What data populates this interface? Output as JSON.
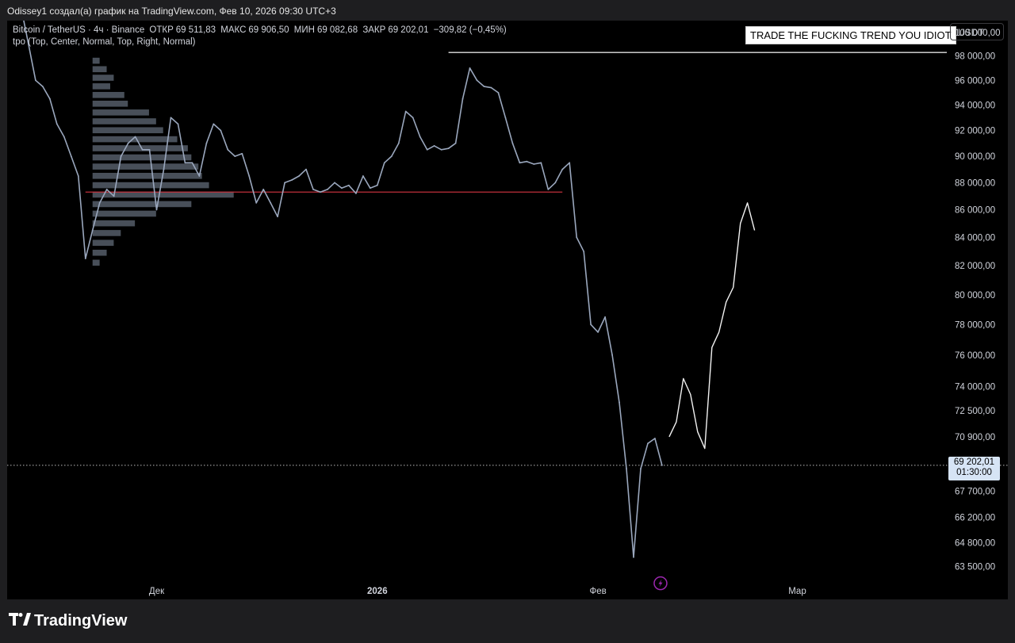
{
  "header": {
    "caption": "Odissey1 создал(а) график на TradingView.com, Фев 10, 2026 09:30 UTC+3"
  },
  "legend": {
    "symbol": "Bitcoin / TetherUS · 4ч · Binance",
    "open_label": "ОТКР",
    "open_value": "69 511,83",
    "high_label": "МАКС",
    "high_value": "69 906,50",
    "low_label": "МИН",
    "low_value": "69 082,68",
    "close_label": "ЗАКР",
    "close_value": "69 202,01",
    "change": "−309,82 (−0,45%)",
    "indicator": "tpo (Top, Center, Normal, Top, Right, Normal)"
  },
  "banner": {
    "text": "TRADE THE FUCKING TREND YOU IDIOT"
  },
  "currency": {
    "label": "USDT"
  },
  "last_price": {
    "price": "69 202,01",
    "countdown": "01:30:00"
  },
  "footer": {
    "brand": "TradingView"
  },
  "colors": {
    "background": "#000000",
    "candles": "#9aa7bd",
    "poc_line": "#c0303b",
    "volume_profile": "#505863",
    "price_tag": "#d6e4f5",
    "marker": "#9c27b0"
  },
  "icons": {
    "brand_logo": "tradingview-logo",
    "event_marker": "lightning-icon"
  },
  "chart_data": {
    "type": "line",
    "title": "Bitcoin / TetherUS · 4ч · Binance",
    "y_scale": "log",
    "ylim": [
      62500,
      101000
    ],
    "y_ticks": [
      100000,
      98000,
      96000,
      94000,
      92000,
      90000,
      88000,
      86000,
      84000,
      82000,
      80000,
      78000,
      76000,
      74000,
      72500,
      70900,
      67700,
      66200,
      64800,
      63500
    ],
    "y_tick_labels": [
      "100 000,00",
      "98 000,00",
      "96 000,00",
      "94 000,00",
      "92 000,00",
      "90 000,00",
      "88 000,00",
      "86 000,00",
      "84 000,00",
      "82 000,00",
      "80 000,00",
      "78 000,00",
      "76 000,00",
      "74 000,00",
      "72 500,00",
      "70 900,00",
      "67 700,00",
      "66 200,00",
      "64 800,00",
      "63 500,00"
    ],
    "x_tick_labels": [
      {
        "label": "Дек",
        "date": "2025-12-01"
      },
      {
        "label": "2026",
        "date": "2026-01-01",
        "bold": true
      },
      {
        "label": "Фев",
        "date": "2026-02-01"
      },
      {
        "label": "Мар",
        "date": "2026-03-01"
      }
    ],
    "xlim": [
      "2025-11-10",
      "2026-03-22"
    ],
    "series": [
      {
        "type": "line",
        "points": [
          [
            "2025-11-11",
            105000
          ],
          [
            "2025-11-12",
            102000
          ],
          [
            "2025-11-13",
            99000
          ],
          [
            "2025-11-14",
            96000
          ],
          [
            "2025-11-15",
            95500
          ],
          [
            "2025-11-16",
            94500
          ],
          [
            "2025-11-17",
            92500
          ],
          [
            "2025-11-18",
            91500
          ],
          [
            "2025-11-19",
            90000
          ],
          [
            "2025-11-20",
            88500
          ],
          [
            "2025-11-21",
            82500
          ],
          [
            "2025-11-22",
            84500
          ],
          [
            "2025-11-23",
            86500
          ],
          [
            "2025-11-24",
            87500
          ],
          [
            "2025-11-25",
            87000
          ],
          [
            "2025-11-26",
            90000
          ],
          [
            "2025-11-27",
            91000
          ],
          [
            "2025-11-28",
            91500
          ],
          [
            "2025-11-29",
            90500
          ],
          [
            "2025-11-30",
            90500
          ],
          [
            "2025-12-01",
            86000
          ],
          [
            "2025-12-02",
            89000
          ],
          [
            "2025-12-03",
            93000
          ],
          [
            "2025-12-04",
            92500
          ],
          [
            "2025-12-05",
            89500
          ],
          [
            "2025-12-06",
            89500
          ],
          [
            "2025-12-07",
            88500
          ],
          [
            "2025-12-08",
            91000
          ],
          [
            "2025-12-09",
            92500
          ],
          [
            "2025-12-10",
            92000
          ],
          [
            "2025-12-11",
            90500
          ],
          [
            "2025-12-12",
            90000
          ],
          [
            "2025-12-13",
            90200
          ],
          [
            "2025-12-14",
            88500
          ],
          [
            "2025-12-15",
            86500
          ],
          [
            "2025-12-16",
            87500
          ],
          [
            "2025-12-17",
            86500
          ],
          [
            "2025-12-18",
            85500
          ],
          [
            "2025-12-19",
            88000
          ],
          [
            "2025-12-20",
            88200
          ],
          [
            "2025-12-21",
            88500
          ],
          [
            "2025-12-22",
            89000
          ],
          [
            "2025-12-23",
            87500
          ],
          [
            "2025-12-24",
            87300
          ],
          [
            "2025-12-25",
            87500
          ],
          [
            "2025-12-26",
            88000
          ],
          [
            "2025-12-27",
            87600
          ],
          [
            "2025-12-28",
            87800
          ],
          [
            "2025-12-29",
            87200
          ],
          [
            "2025-12-30",
            88500
          ],
          [
            "2025-12-31",
            87600
          ],
          [
            "2026-01-01",
            87800
          ],
          [
            "2026-01-02",
            89500
          ],
          [
            "2026-01-03",
            90000
          ],
          [
            "2026-01-04",
            91000
          ],
          [
            "2026-01-05",
            93500
          ],
          [
            "2026-01-06",
            93000
          ],
          [
            "2026-01-07",
            91500
          ],
          [
            "2026-01-08",
            90500
          ],
          [
            "2026-01-09",
            90800
          ],
          [
            "2026-01-10",
            90500
          ],
          [
            "2026-01-11",
            90600
          ],
          [
            "2026-01-12",
            91000
          ],
          [
            "2026-01-13",
            94500
          ],
          [
            "2026-01-14",
            97000
          ],
          [
            "2026-01-15",
            96000
          ],
          [
            "2026-01-16",
            95500
          ],
          [
            "2026-01-17",
            95400
          ],
          [
            "2026-01-18",
            95000
          ],
          [
            "2026-01-19",
            93000
          ],
          [
            "2026-01-20",
            91000
          ],
          [
            "2026-01-21",
            89500
          ],
          [
            "2026-01-22",
            89600
          ],
          [
            "2026-01-23",
            89400
          ],
          [
            "2026-01-24",
            89500
          ],
          [
            "2026-01-25",
            87500
          ],
          [
            "2026-01-26",
            88000
          ],
          [
            "2026-01-27",
            89000
          ],
          [
            "2026-01-28",
            89500
          ],
          [
            "2026-01-29",
            84000
          ],
          [
            "2026-01-30",
            83000
          ],
          [
            "2026-01-31",
            78000
          ],
          [
            "2026-02-01",
            77500
          ],
          [
            "2026-02-02",
            78500
          ],
          [
            "2026-02-03",
            76000
          ],
          [
            "2026-02-04",
            73000
          ],
          [
            "2026-02-05",
            69000
          ],
          [
            "2026-02-06",
            64000
          ],
          [
            "2026-02-07",
            69000
          ],
          [
            "2026-02-08",
            70500
          ],
          [
            "2026-02-09",
            70800
          ],
          [
            "2026-02-10",
            69202
          ]
        ]
      },
      {
        "type": "line",
        "name": "",
        "style": "drawing",
        "points": [
          [
            "2026-02-11",
            70900
          ],
          [
            "2026-02-12",
            71800
          ],
          [
            "2026-02-13",
            74500
          ],
          [
            "2026-02-14",
            73500
          ],
          [
            "2026-02-15",
            71200
          ],
          [
            "2026-02-16",
            70200
          ],
          [
            "2026-02-17",
            76500
          ],
          [
            "2026-02-18",
            77500
          ],
          [
            "2026-02-19",
            79500
          ],
          [
            "2026-02-20",
            80500
          ],
          [
            "2026-02-21",
            85000
          ],
          [
            "2026-02-22",
            86500
          ],
          [
            "2026-02-23",
            84500
          ]
        ]
      }
    ],
    "horizontal_lines": [
      {
        "price": 98300,
        "from": "2026-01-11",
        "color": "#e0e0e0"
      },
      {
        "price": 87300,
        "from": "2025-11-21",
        "to": "2026-01-27",
        "color": "#c0303b"
      },
      {
        "price": 69202.01,
        "color": "#bbbbbb",
        "dotted": true
      }
    ],
    "volume_profile": [
      {
        "price": 97600,
        "volume": 2
      },
      {
        "price": 96900,
        "volume": 4
      },
      {
        "price": 96200,
        "volume": 6
      },
      {
        "price": 95500,
        "volume": 5
      },
      {
        "price": 94800,
        "volume": 9
      },
      {
        "price": 94100,
        "volume": 10
      },
      {
        "price": 93400,
        "volume": 16
      },
      {
        "price": 92700,
        "volume": 18
      },
      {
        "price": 92000,
        "volume": 20
      },
      {
        "price": 91300,
        "volume": 24
      },
      {
        "price": 90600,
        "volume": 27
      },
      {
        "price": 89900,
        "volume": 28
      },
      {
        "price": 89200,
        "volume": 30
      },
      {
        "price": 88500,
        "volume": 31
      },
      {
        "price": 87800,
        "volume": 33
      },
      {
        "price": 87100,
        "volume": 40
      },
      {
        "price": 86400,
        "volume": 28
      },
      {
        "price": 85700,
        "volume": 18
      },
      {
        "price": 85000,
        "volume": 12
      },
      {
        "price": 84300,
        "volume": 8
      },
      {
        "price": 83600,
        "volume": 6
      },
      {
        "price": 82900,
        "volume": 4
      },
      {
        "price": 82200,
        "volume": 2
      }
    ],
    "markers": [
      {
        "date": "2026-02-08",
        "price": 62600,
        "icon": "lightning-icon"
      }
    ],
    "grid": false,
    "legend_position": "top-left"
  }
}
